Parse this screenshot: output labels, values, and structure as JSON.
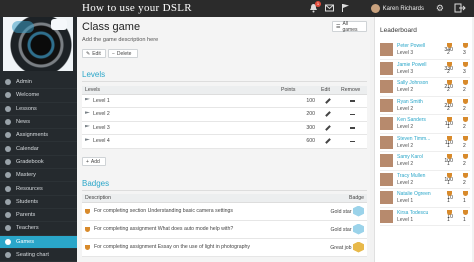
{
  "header": {
    "title": "How to use your DSLR",
    "user_name": "Karen Richards",
    "notification_count": "1"
  },
  "sidebar": {
    "items": [
      {
        "label": "Admin"
      },
      {
        "label": "Welcome"
      },
      {
        "label": "Lessons"
      },
      {
        "label": "News"
      },
      {
        "label": "Assignments"
      },
      {
        "label": "Calendar"
      },
      {
        "label": "Gradebook"
      },
      {
        "label": "Mastery"
      },
      {
        "label": "Resources"
      },
      {
        "label": "Students"
      },
      {
        "label": "Parents"
      },
      {
        "label": "Teachers"
      },
      {
        "label": "Games"
      },
      {
        "label": "Seating chart"
      }
    ],
    "active": "Games"
  },
  "main": {
    "title": "Class game",
    "description": "Add the game description here",
    "edit_label": "Edit",
    "delete_label": "Delete",
    "all_games_label": "All games",
    "levels": {
      "heading": "Levels",
      "columns": [
        "Levels",
        "Points",
        "Edit",
        "Remove"
      ],
      "rows": [
        {
          "name": "Level 1",
          "points": "100"
        },
        {
          "name": "Level 2",
          "points": "200"
        },
        {
          "name": "Level 3",
          "points": "300"
        },
        {
          "name": "Level 4",
          "points": "600"
        }
      ],
      "add_label": "Add"
    },
    "badges": {
      "heading": "Badges",
      "columns": [
        "Description",
        "Badge"
      ],
      "rows": [
        {
          "description": "For completing section Understanding basic camera settings",
          "badge": "Gold star"
        },
        {
          "description": "For completing assignment What does auto mode help with?",
          "badge": "Gold star"
        },
        {
          "description": "For completing assignment Essay on the use of light in photography",
          "badge": "Great job"
        }
      ]
    }
  },
  "leaderboard": {
    "title": "Leaderboard",
    "entries": [
      {
        "name": "Peter Powell",
        "level": "Level 3",
        "points": "340",
        "a": "2",
        "b": "3"
      },
      {
        "name": "Jamie Powell",
        "level": "Level 3",
        "points": "330",
        "a": "2",
        "b": "3"
      },
      {
        "name": "Sally Johnson",
        "level": "Level 2",
        "points": "210",
        "a": "2",
        "b": "2"
      },
      {
        "name": "Ryan Smith",
        "level": "Level 2",
        "points": "210",
        "a": "2",
        "b": "2"
      },
      {
        "name": "Ken Sanders",
        "level": "Level 2",
        "points": "110",
        "a": "1",
        "b": "2"
      },
      {
        "name": "Steven Timm...",
        "level": "Level 2",
        "points": "110",
        "a": "1",
        "b": "2"
      },
      {
        "name": "Samy Karol",
        "level": "Level 2",
        "points": "100",
        "a": "1",
        "b": "2"
      },
      {
        "name": "Tracy Mullen",
        "level": "Level 2",
        "points": "100",
        "a": "1",
        "b": "2"
      },
      {
        "name": "Natalie Ogreen",
        "level": "Level 1",
        "points": "10",
        "a": "1",
        "b": "1"
      },
      {
        "name": "Kirsa Todescu",
        "level": "Level 1",
        "points": "10",
        "a": "1",
        "b": "1"
      }
    ]
  },
  "colors": {
    "accent": "#2aa6c9",
    "sidebar_bg": "#252a2e",
    "topbar_bg": "#2b2b2b",
    "trophy": "#d88a2b"
  }
}
